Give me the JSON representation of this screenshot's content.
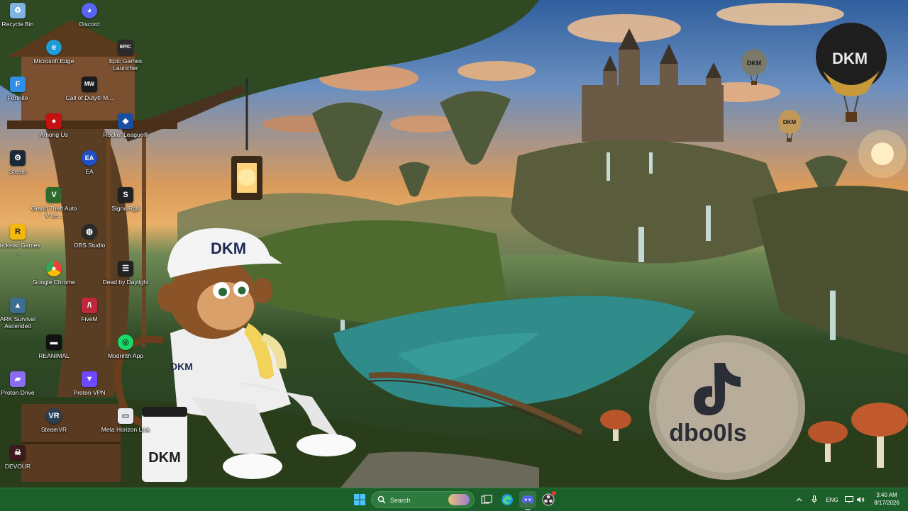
{
  "desktop": {
    "icons": [
      {
        "label": "Recycle Bin",
        "icon": "recycle-bin-icon",
        "color": "#7fb3e0"
      },
      {
        "label": "Discord",
        "icon": "discord-icon",
        "color": "#5865f2"
      },
      {
        "label": "Microsoft Edge",
        "icon": "edge-icon",
        "color": "#1f9bd6"
      },
      {
        "label": "Epic Games Launcher",
        "icon": "epic-games-icon",
        "color": "#2a2a2a"
      },
      {
        "label": "Fortnite",
        "icon": "fortnite-icon",
        "color": "#2f8fe6"
      },
      {
        "label": "Call of Duty® M...",
        "icon": "call-of-duty-icon",
        "color": "#1a1a1a"
      },
      {
        "label": "Among Us",
        "icon": "among-us-icon",
        "color": "#c51111"
      },
      {
        "label": "Rocket League®",
        "icon": "rocket-league-icon",
        "color": "#1a4fa0"
      },
      {
        "label": "Steam",
        "icon": "steam-icon",
        "color": "#1b2838"
      },
      {
        "label": "EA",
        "icon": "ea-icon",
        "color": "#2050c8"
      },
      {
        "label": "Grand Theft Auto V Le...",
        "icon": "gta-icon",
        "color": "#2d6a2d"
      },
      {
        "label": "SignalRgb",
        "icon": "signalrgb-icon",
        "color": "#222"
      },
      {
        "label": "Rockstar Games ...",
        "icon": "rockstar-icon",
        "color": "#f2b90c"
      },
      {
        "label": "OBS Studio",
        "icon": "obs-icon",
        "color": "#2b2b2b"
      },
      {
        "label": "Google Chrome",
        "icon": "chrome-icon",
        "color": "#ea4335"
      },
      {
        "label": "Dead by Daylight",
        "icon": "dead-by-daylight-icon",
        "color": "#222"
      },
      {
        "label": "ARK Survival Ascended",
        "icon": "ark-icon",
        "color": "#3c6e8f"
      },
      {
        "label": "FiveM",
        "icon": "fivem-icon",
        "color": "#c0283c"
      },
      {
        "label": "REANIMAL",
        "icon": "reanimal-icon",
        "color": "#111"
      },
      {
        "label": "Modrinth App",
        "icon": "modrinth-icon",
        "color": "#1bd96a"
      },
      {
        "label": "Proton Drive",
        "icon": "proton-drive-icon",
        "color": "#8a6cf0"
      },
      {
        "label": "Proton VPN",
        "icon": "proton-vpn-icon",
        "color": "#6d4aff"
      },
      {
        "label": "SteamVR",
        "icon": "steamvr-icon",
        "color": "#2a3f55"
      },
      {
        "label": "Meta Horizon Link",
        "icon": "meta-horizon-icon",
        "color": "#e8e8f0"
      },
      {
        "label": "DEVOUR",
        "icon": "devour-icon",
        "color": "#3a1a1a"
      }
    ]
  },
  "wallpaper": {
    "cap_text": "DKM",
    "shirt_text": "DKM",
    "cup_text": "DKM",
    "balloon_text": "DKM",
    "balloon_small_1": "DKM",
    "balloon_small_2": "DKM",
    "rock_text": "dbo0ls"
  },
  "taskbar": {
    "color": "#1c5f2a",
    "search_placeholder": "Search",
    "pinned": [
      {
        "name": "start-button",
        "icon": "windows-icon"
      },
      {
        "name": "task-view-button",
        "icon": "task-view-icon"
      },
      {
        "name": "edge-taskbar",
        "icon": "edge-icon"
      },
      {
        "name": "discord-taskbar",
        "icon": "discord-icon"
      },
      {
        "name": "obs-taskbar",
        "icon": "obs-icon"
      }
    ],
    "tray": {
      "language": "ENG",
      "time": "3:40 AM",
      "date": "8/17/2026"
    }
  }
}
